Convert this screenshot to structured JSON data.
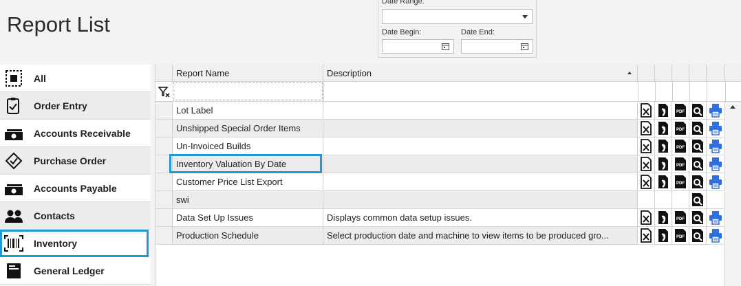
{
  "page": {
    "title": "Report List"
  },
  "date_filter": {
    "range_label": "Date Range:",
    "range_value": "",
    "begin_label": "Date Begin:",
    "begin_value": "",
    "end_label": "Date End:",
    "end_value": ""
  },
  "sidebar": {
    "items": [
      {
        "label": "All",
        "icon": "all-icon"
      },
      {
        "label": "Order Entry",
        "icon": "clipboard-check-icon"
      },
      {
        "label": "Accounts Receivable",
        "icon": "cash-icon"
      },
      {
        "label": "Purchase Order",
        "icon": "badge-check-icon"
      },
      {
        "label": "Accounts Payable",
        "icon": "cash-icon"
      },
      {
        "label": "Contacts",
        "icon": "people-icon"
      },
      {
        "label": "Inventory",
        "icon": "barcode-icon",
        "selected": true
      },
      {
        "label": "General Ledger",
        "icon": "ledger-icon"
      }
    ]
  },
  "grid": {
    "columns": {
      "name": "Report Name",
      "description": "Description"
    },
    "filter_value": "",
    "rows": [
      {
        "name": "Lot Label",
        "description": "",
        "actions": [
          "excel",
          "word",
          "pdf",
          "preview",
          "print"
        ]
      },
      {
        "name": "Unshipped Special Order Items",
        "description": "",
        "actions": [
          "excel",
          "word",
          "pdf",
          "preview",
          "print"
        ]
      },
      {
        "name": "Un-Invoiced Builds",
        "description": "",
        "actions": [
          "excel",
          "word",
          "pdf",
          "preview",
          "print"
        ]
      },
      {
        "name": "Inventory Valuation By Date",
        "description": "",
        "actions": [
          "excel",
          "word",
          "pdf",
          "preview",
          "print"
        ]
      },
      {
        "name": "Customer Price List Export",
        "description": "",
        "actions": [
          "excel",
          "word",
          "pdf",
          "preview",
          "print"
        ]
      },
      {
        "name": "swi",
        "description": "",
        "actions": [
          "preview"
        ]
      },
      {
        "name": "Data Set Up Issues",
        "description": "Displays common data setup issues.",
        "actions": [
          "excel",
          "word",
          "pdf",
          "preview",
          "print"
        ]
      },
      {
        "name": "Production Schedule",
        "description": "Select production date and machine to view items to be produced gro...",
        "actions": [
          "excel",
          "word",
          "pdf",
          "preview",
          "print"
        ]
      }
    ]
  },
  "colors": {
    "accent": "#1e9ad6",
    "print": "#2f6fe0"
  }
}
